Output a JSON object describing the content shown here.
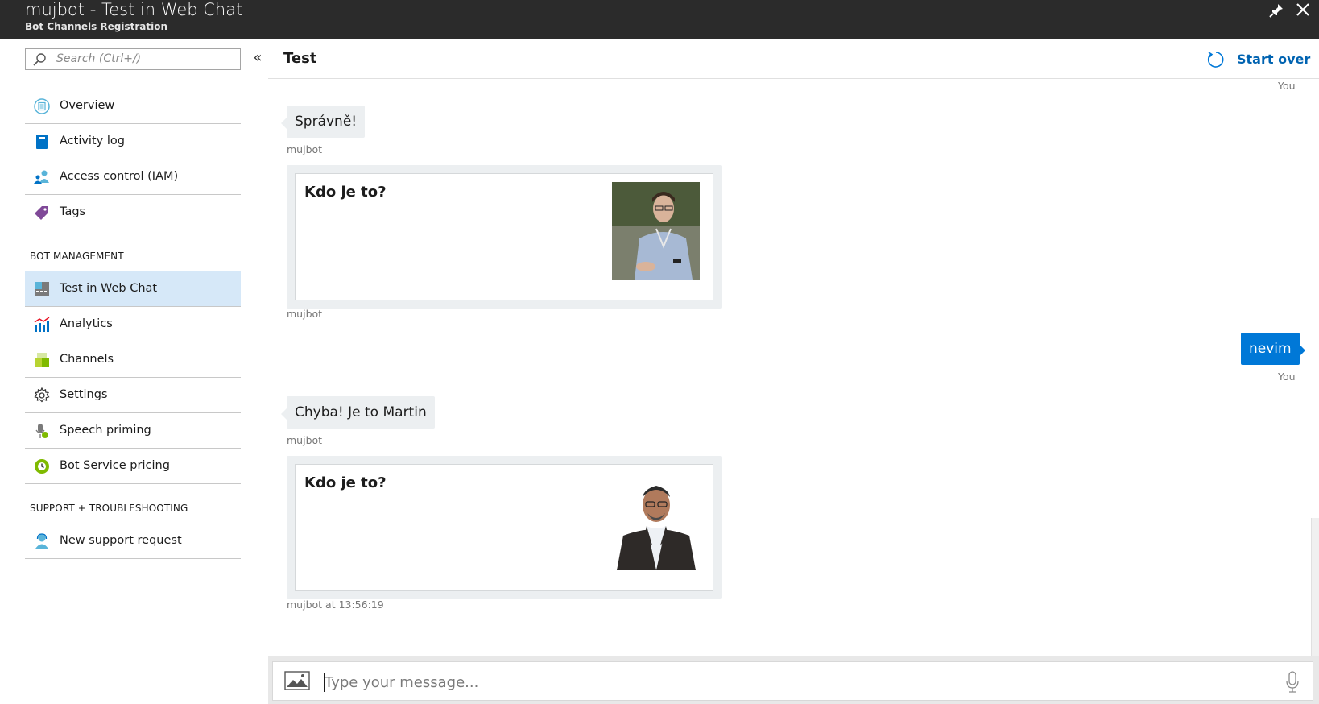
{
  "window": {
    "title": "mujbot - Test in Web Chat",
    "subtitle": "Bot Channels Registration"
  },
  "sidebar": {
    "search_placeholder": "Search (Ctrl+/)",
    "collapse_glyph": "«",
    "items": [
      {
        "label": "Overview",
        "icon": "overview-icon"
      },
      {
        "label": "Activity log",
        "icon": "activity-log-icon"
      },
      {
        "label": "Access control (IAM)",
        "icon": "access-control-icon"
      },
      {
        "label": "Tags",
        "icon": "tag-icon"
      }
    ],
    "section_bot_management": "BOT MANAGEMENT",
    "bot_items": [
      {
        "label": "Test in Web Chat",
        "icon": "web-chat-icon",
        "active": true
      },
      {
        "label": "Analytics",
        "icon": "analytics-icon"
      },
      {
        "label": "Channels",
        "icon": "channels-icon"
      },
      {
        "label": "Settings",
        "icon": "gear-icon"
      },
      {
        "label": "Speech priming",
        "icon": "speech-priming-icon"
      },
      {
        "label": "Bot Service pricing",
        "icon": "pricing-icon"
      }
    ],
    "section_support": "SUPPORT + TROUBLESHOOTING",
    "support_items": [
      {
        "label": "New support request",
        "icon": "support-icon"
      }
    ]
  },
  "main": {
    "title": "Test",
    "start_over_label": "Start over"
  },
  "chat": {
    "user_name_top": "You",
    "messages": [
      {
        "from": "mujbot",
        "text": "Správně!",
        "sender_label": "mujbot"
      },
      {
        "from": "mujbot",
        "card_title": "Kdo je to?",
        "sender_label": "mujbot"
      },
      {
        "from": "user",
        "text": "nevim",
        "sender_label": "You"
      },
      {
        "from": "mujbot",
        "text": "Chyba! Je to Martin",
        "sender_label": "mujbot"
      },
      {
        "from": "mujbot",
        "card_title": "Kdo je to?",
        "sender_label": "mujbot at 13:56:19"
      }
    ]
  },
  "composer": {
    "placeholder": "Type your message..."
  },
  "colors": {
    "titlebar_bg": "#2b2b2b",
    "accent": "#0078d7",
    "active_nav_bg": "#d6e8f8",
    "bot_bubble_bg": "#eceff1"
  }
}
